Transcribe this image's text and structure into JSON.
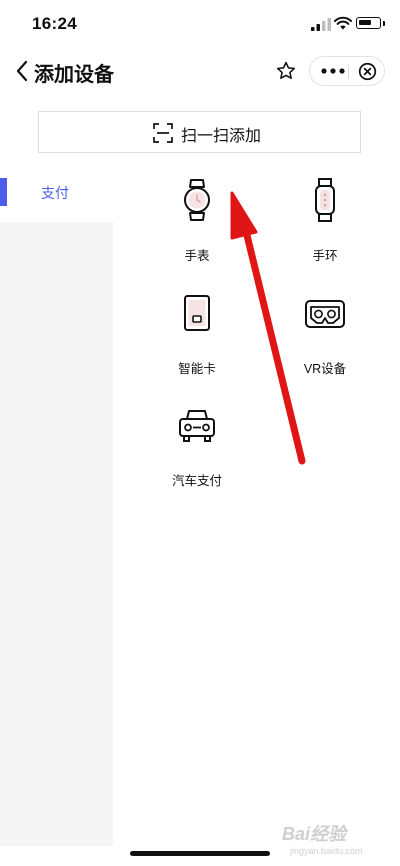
{
  "status_bar": {
    "time": "16:24"
  },
  "nav": {
    "title": "添加设备"
  },
  "scan": {
    "label": "扫一扫添加"
  },
  "sidebar": {
    "items": [
      {
        "label": "支付",
        "selected": true
      }
    ]
  },
  "devices": [
    {
      "label": "手表",
      "icon": "watch-icon"
    },
    {
      "label": "手环",
      "icon": "band-icon"
    },
    {
      "label": "智能卡",
      "icon": "smart-card-icon"
    },
    {
      "label": "VR设备",
      "icon": "vr-headset-icon"
    },
    {
      "label": "汽车支付",
      "icon": "car-icon"
    }
  ],
  "colors": {
    "accent": "#4b5fe8",
    "annotation_arrow": "#e01515",
    "sidebar_bg": "#f5f5f5"
  },
  "watermark": {
    "text": "Bai经验",
    "sub": "jingyan.baidu.com"
  }
}
